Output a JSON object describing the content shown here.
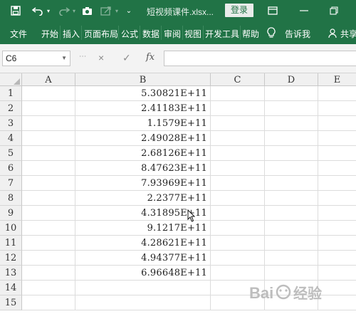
{
  "titlebar": {
    "document_title": "短视频课件.xlsx...",
    "login_label": "登录",
    "icons": [
      "save-icon",
      "undo-icon",
      "redo-icon",
      "camera-icon",
      "share-icon",
      "customize-icon",
      "ribbon-display-icon",
      "minimize-icon",
      "restore-icon"
    ]
  },
  "ribbon": {
    "tabs": [
      "文件",
      "开始",
      "插入",
      "页面布局",
      "公式",
      "数据",
      "审阅",
      "视图",
      "开发工具",
      "帮助"
    ],
    "tell_me": "告诉我",
    "share": "共享"
  },
  "formula_bar": {
    "name_box": "C6",
    "cancel_icon": "×",
    "enter_icon": "✓",
    "fx_label": "fx",
    "formula": ""
  },
  "sheet": {
    "columns": [
      "A",
      "B",
      "C",
      "D",
      "E"
    ],
    "rows": [
      "1",
      "2",
      "3",
      "4",
      "5",
      "6",
      "7",
      "8",
      "9",
      "10",
      "11",
      "12",
      "13",
      "14",
      "15"
    ],
    "column_b_values": [
      "5.30821E+11",
      "2.41183E+11",
      "1.1579E+11",
      "2.49028E+11",
      "2.68126E+11",
      "8.47623E+11",
      "7.93969E+11",
      "2.2377E+11",
      "4.31895E+11",
      "9.1217E+11",
      "4.28621E+11",
      "4.94377E+11",
      "6.96648E+11",
      "",
      ""
    ]
  },
  "watermark": "Bai 经验"
}
